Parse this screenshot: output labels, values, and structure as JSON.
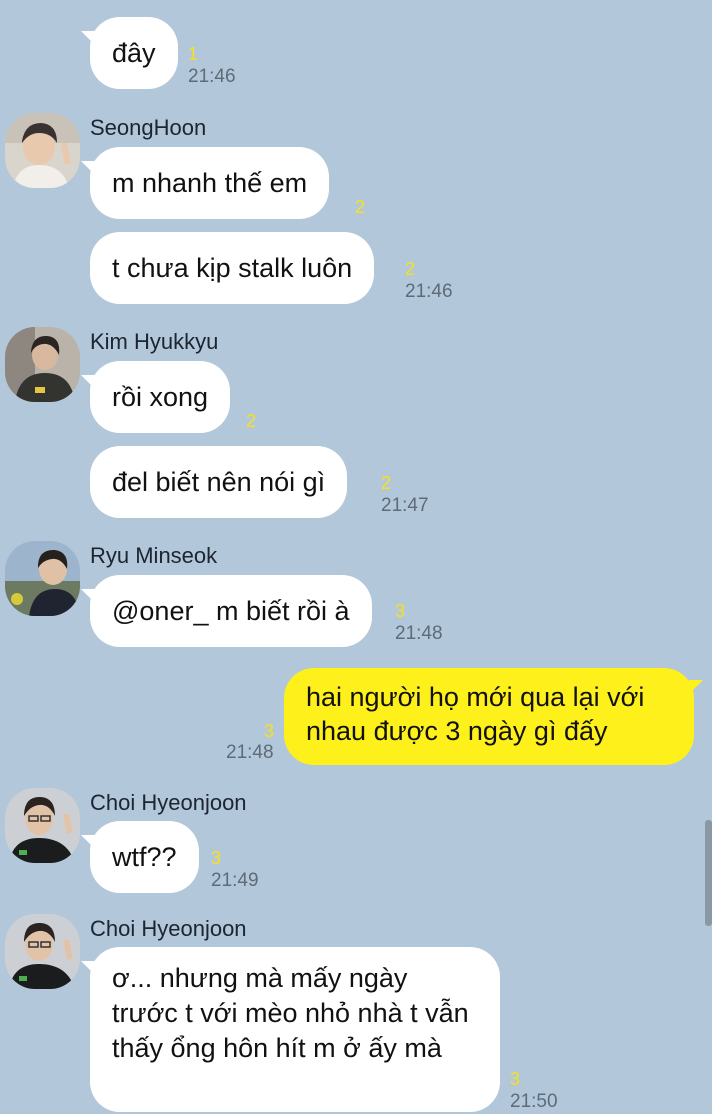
{
  "messages": [
    {
      "text": "đây",
      "count": "1",
      "time": "21:46"
    },
    {
      "sender": "SeongHoon",
      "text": "m nhanh thế em",
      "count": "2"
    },
    {
      "text": "t chưa kịp stalk luôn",
      "count": "2",
      "time": "21:46"
    },
    {
      "sender": "Kim Hyukkyu",
      "text": "rồi xong",
      "count": "2"
    },
    {
      "text": "đel biết nên nói gì",
      "count": "2",
      "time": "21:47"
    },
    {
      "sender": "Ryu Minseok",
      "text": "@oner_ m biết rồi à",
      "count": "3",
      "time": "21:48"
    },
    {
      "text": "hai người họ mới qua lại với nhau được 3 ngày gì đấy",
      "count": "3",
      "time": "21:48",
      "mine": true
    },
    {
      "sender": "Choi Hyeonjoon",
      "text": "wtf??",
      "count": "3",
      "time": "21:49"
    },
    {
      "sender": "Choi Hyeonjoon",
      "text": "ơ... nhưng mà mấy ngày trước t với mèo nhỏ nhà t vẫn thấy ổng hôn hít m ở ấy mà",
      "count": "3",
      "time": "21:50"
    }
  ],
  "colors": {
    "background": "#b2c7da",
    "bubble_other": "#ffffff",
    "bubble_mine": "#fef01b",
    "read_count": "#f7e11c",
    "timestamp": "#5e6b78"
  }
}
